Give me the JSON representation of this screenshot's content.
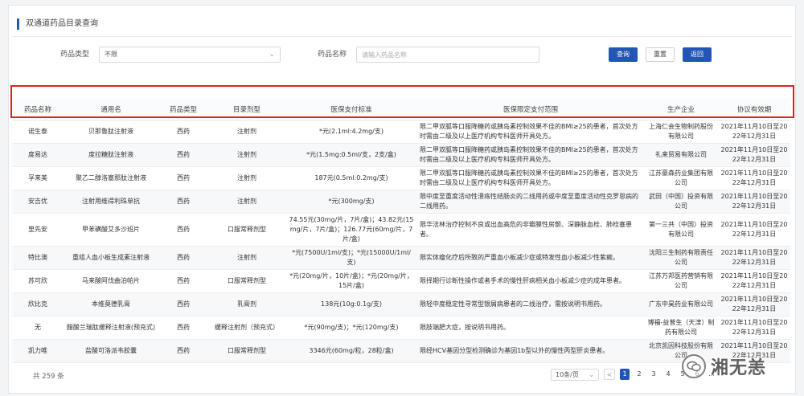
{
  "page_title": "双通道药品目录查询",
  "filters": {
    "type_label": "药品类型",
    "type_value": "不限",
    "name_label": "药品名称",
    "name_placeholder": "请输入药品名称",
    "search_label": "查询",
    "reset_label": "重置",
    "back_label": "返回"
  },
  "table": {
    "headers": [
      "药品名称",
      "通用名",
      "药品类型",
      "目录剂型",
      "医保支付标准",
      "医保限定支付范围",
      "生产企业",
      "协议有效期"
    ],
    "rows": [
      [
        "诺生泰",
        "贝那鲁肽注射液",
        "西药",
        "注射剂",
        "*元(2.1ml:4.2mg/支)",
        "限二甲双胍等口服降糖药或胰岛素控制效果不佳的BMI≥25的患者，首次处方时需由二级及以上医疗机构专科医师开具处方。",
        "上海仁会生物制药股份有限公司",
        "2021年11月10日至2022年12月31日"
      ],
      [
        "度易达",
        "度拉糖肽注射液",
        "西药",
        "注射剂",
        "*元(1.5mg:0.5ml/支，2支/盒)",
        "限二甲双胍等口服降糖药或胰岛素控制效果不佳的BMI≥25的患者，首次处方时需由二级及以上医疗机构专科医师开具处方。",
        "礼来贸易有限公司",
        "2021年11月10日至2022年12月31日"
      ],
      [
        "孚来美",
        "聚乙二醇洛塞那肽注射液",
        "西药",
        "注射剂",
        "187元(0.5ml:0.2mg/支)",
        "限二甲双胍等口服降糖药或胰岛素控制效果不佳的BMI≥25的患者，首次处方时需由二级及以上医疗机构专科医师开具处方。",
        "江苏豪森药业集团有限公司",
        "2021年11月10日至2022年12月31日"
      ],
      [
        "安吉优",
        "注射用维得利珠单抗",
        "西药",
        "注射剂",
        "*元(300mg/支)",
        "限中度至重度活动性溃疡性结肠炎的二线用药或中度至重度活动性克罗恩病的二线用药。",
        "武田（中国）投资有限公司",
        "2021年11月10日至2022年12月31日"
      ],
      [
        "里先安",
        "甲苯磺酸艾多沙班片",
        "西药",
        "口服常释剂型",
        "74.55元(30mg/片，7片/盒)；43.82元(15mg/片，7片/盒)；126.77元(60mg/片，7片/盒)",
        "限华法林治疗控制不良或出血高危的非瓣膜性房颤、深静脉血栓、肺栓塞患者。",
        "第一三共（中国）投资有限公司",
        "2021年11月10日至2022年12月31日"
      ],
      [
        "特比澳",
        "重组人血小板生成素注射液",
        "西药",
        "注射剂",
        "*元(7500U/1ml/支)；*元(15000U/1ml/支)",
        "限实体瘤化疗后所致的严重血小板减少症或特发性血小板减少性紫癜。",
        "沈阳三生制药有限责任公司",
        "2021年11月10日至2022年12月31日"
      ],
      [
        "苏可欣",
        "马来酸阿伐曲泊帕片",
        "西药",
        "口服常释剂型",
        "*元(20mg/片，10片/盒)；*元(20mg/片，15片/盒)",
        "限择期行诊断性操作或者手术的慢性肝病相关血小板减少症的成年患者。",
        "江苏万邦医药营销有限公司",
        "2021年11月10日至2022年12月31日"
      ],
      [
        "欣比克",
        "本维莫德乳膏",
        "西药",
        "乳膏剂",
        "138元(10g:0.1g/支)",
        "限轻中度稳定性寻常型银屑病患者的二线治疗，需按说明书用药。",
        "广东中昊药业有限公司",
        "2021年11月10日至2022年12月31日"
      ],
      [
        "无",
        "醋酸兰瑞肽缓释注射液(预充式)",
        "西药",
        "缓释注射剂（预充式）",
        "*元(90mg/支)；*元(120mg/支)",
        "限肢端肥大症，按说明书用药。",
        "博福-益普生（天津）制药有限公司",
        "2021年11月10日至2022年12月31日"
      ],
      [
        "凯力唯",
        "盐酸可洛派韦胶囊",
        "西药",
        "口服常释剂型",
        "3346元(60mg/粒，28粒/盒)",
        "限经HCV基因分型检测确诊为基因1b型以外的慢性丙型肝炎患者。",
        "北京凯因科技股份有限公司",
        "2021年11月10日至2022年12月31日"
      ]
    ]
  },
  "footer": {
    "total_text": "共 259 条",
    "page_size": "10条/页",
    "prev": "<",
    "pages": [
      "1",
      "2",
      "3",
      "4",
      "5",
      "6",
      "..."
    ],
    "active_page": "1"
  },
  "watermark": {
    "text": "湘无恙"
  },
  "colors": {
    "primary": "#2256b6",
    "highlight_frame": "#e02020"
  }
}
